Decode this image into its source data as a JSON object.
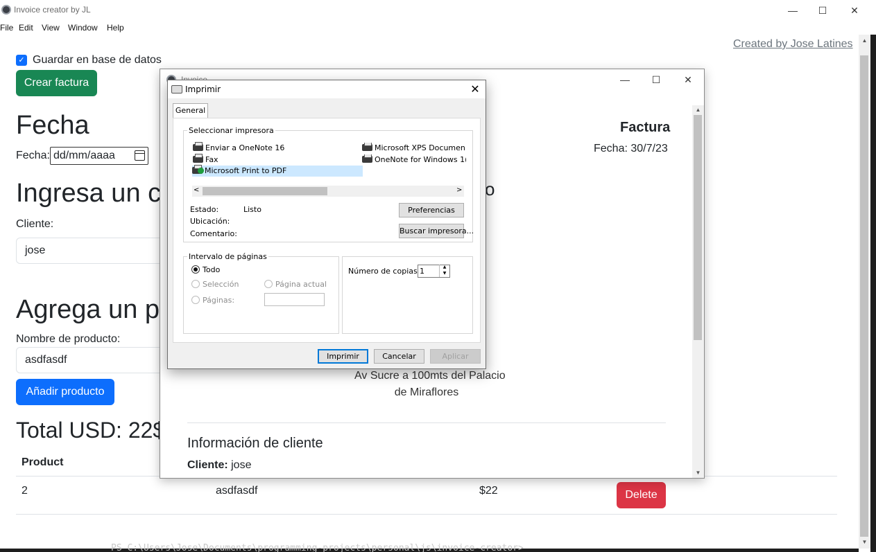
{
  "window": {
    "title": "Invoice creator by JL",
    "minimize": "—",
    "maximize": "☐",
    "close": "✕"
  },
  "menu": [
    "File",
    "Edit",
    "View",
    "Window",
    "Help"
  ],
  "header": {
    "credit_link": "Created by Jose Latines"
  },
  "form": {
    "save_db_label": "Guardar en base de datos",
    "save_db_checked": true,
    "create_button": "Crear factura",
    "fecha_heading": "Fecha",
    "fecha_label": "Fecha:",
    "fecha_value": "dd/mm/aaaa",
    "client_heading": "Ingresa un c",
    "client_label": "Cliente:",
    "client_value": "jose",
    "product_heading": "Agrega un p",
    "product_label": "Nombre de producto:",
    "product_value": "asdfasdf",
    "add_button": "Añadir producto",
    "total": "Total USD: 22$"
  },
  "table": {
    "headers": [
      "Product"
    ],
    "rows": [
      {
        "cells": [
          "2",
          "asdfasdf",
          "$22"
        ],
        "action": "Delete"
      }
    ]
  },
  "invoice_window": {
    "title": "Invoice",
    "factura_title": "Factura",
    "fecha": "Fecha: 30/7/23",
    "heading_partial": "o",
    "address_line1": "Av Sucre a 100mts del Palacio",
    "address_line2": "de Miraflores",
    "info_heading": "Información de cliente",
    "client_label": "Cliente:",
    "client_value": "jose"
  },
  "print_dialog": {
    "title": "Imprimir",
    "tab": "General",
    "select_printer_label": "Seleccionar impresora",
    "printers": [
      {
        "name": "Enviar a OneNote 16",
        "selected": false
      },
      {
        "name": "Fax",
        "selected": false
      },
      {
        "name": "Microsoft Print to PDF",
        "selected": true
      },
      {
        "name": "Microsoft XPS Documen",
        "selected": false
      },
      {
        "name": "OneNote for Windows 1(",
        "selected": false
      }
    ],
    "status_label": "Estado:",
    "status_value": "Listo",
    "location_label": "Ubicación:",
    "comment_label": "Comentario:",
    "preferences_button": "Preferencias",
    "find_printer_button": "Buscar impresora...",
    "page_range_label": "Intervalo de páginas",
    "range_all": "Todo",
    "range_selection": "Selección",
    "range_current": "Página actual",
    "range_pages": "Páginas:",
    "copies_label": "Número de copias:",
    "copies_value": "1",
    "print_button": "Imprimir",
    "cancel_button": "Cancelar",
    "apply_button": "Aplicar"
  },
  "terminal_text": "PS C:\\Users\\Jose\\Documents\\programming-projects\\personal\\js\\invoice-creator>",
  "colors": {
    "primary": "#0d6efd",
    "success": "#198754",
    "danger": "#dc3545",
    "selection": "#cce8ff"
  }
}
